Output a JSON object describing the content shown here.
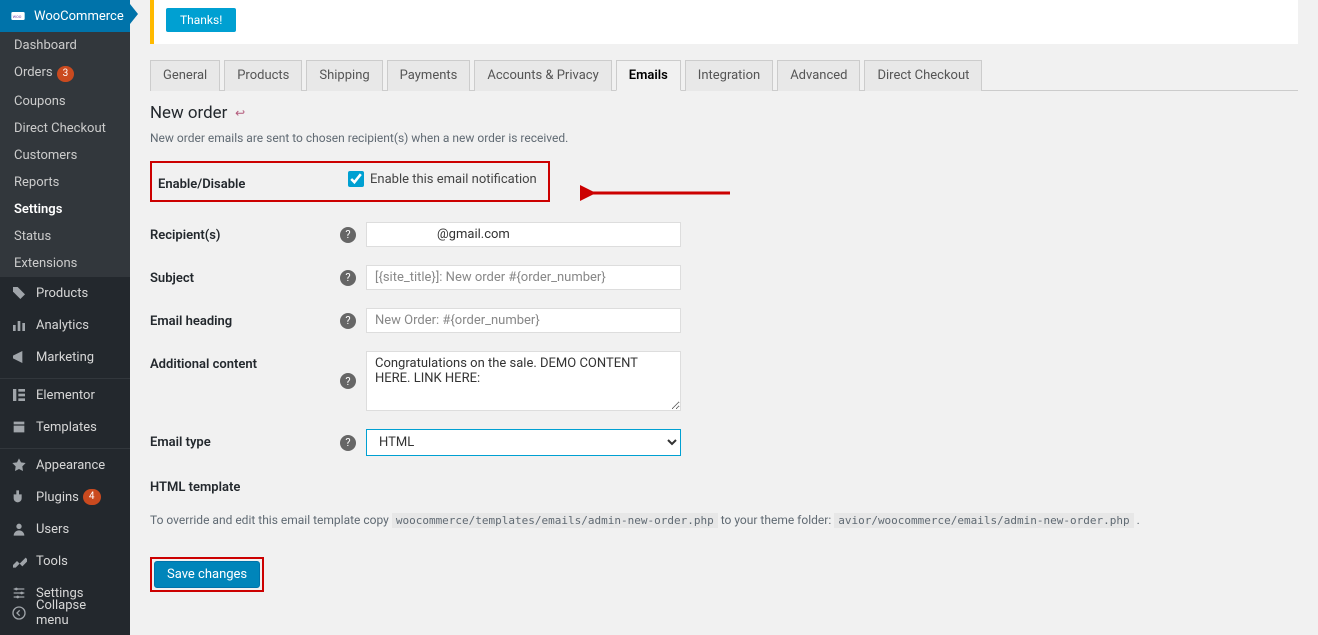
{
  "sidebar": {
    "woocommerce_label": "WooCommerce",
    "submenu": {
      "dashboard": "Dashboard",
      "orders": "Orders",
      "orders_badge": "3",
      "coupons": "Coupons",
      "direct_checkout": "Direct Checkout",
      "customers": "Customers",
      "reports": "Reports",
      "settings": "Settings",
      "status": "Status",
      "extensions": "Extensions"
    },
    "products": "Products",
    "analytics": "Analytics",
    "marketing": "Marketing",
    "elementor": "Elementor",
    "templates": "Templates",
    "appearance": "Appearance",
    "plugins": "Plugins",
    "plugins_badge": "4",
    "users": "Users",
    "tools": "Tools",
    "settings_main": "Settings",
    "collapse": "Collapse menu"
  },
  "banner": {
    "thanks": "Thanks!"
  },
  "tabs": {
    "general": "General",
    "products": "Products",
    "shipping": "Shipping",
    "payments": "Payments",
    "accounts": "Accounts & Privacy",
    "emails": "Emails",
    "integration": "Integration",
    "advanced": "Advanced",
    "direct_checkout": "Direct Checkout"
  },
  "page": {
    "title": "New order",
    "description": "New order emails are sent to chosen recipient(s) when a new order is received."
  },
  "form": {
    "enable_label": "Enable/Disable",
    "enable_checkbox_label": "Enable this email notification",
    "enable_checked": true,
    "recipients_label": "Recipient(s)",
    "recipients_value": "@gmail.com",
    "subject_label": "Subject",
    "subject_placeholder": "[{site_title}]: New order #{order_number}",
    "heading_label": "Email heading",
    "heading_placeholder": "New Order: #{order_number}",
    "additional_label": "Additional content",
    "additional_value": "Congratulations on the sale. DEMO CONTENT HERE. LINK HERE:",
    "email_type_label": "Email type",
    "email_type_value": "HTML",
    "template_label": "HTML template",
    "template_text_pre": "To override and edit this email template copy ",
    "template_path1": "woocommerce/templates/emails/admin-new-order.php",
    "template_text_mid": " to your theme folder: ",
    "template_path2": "avior/woocommerce/emails/admin-new-order.php",
    "template_text_post": " .",
    "save": "Save changes"
  }
}
